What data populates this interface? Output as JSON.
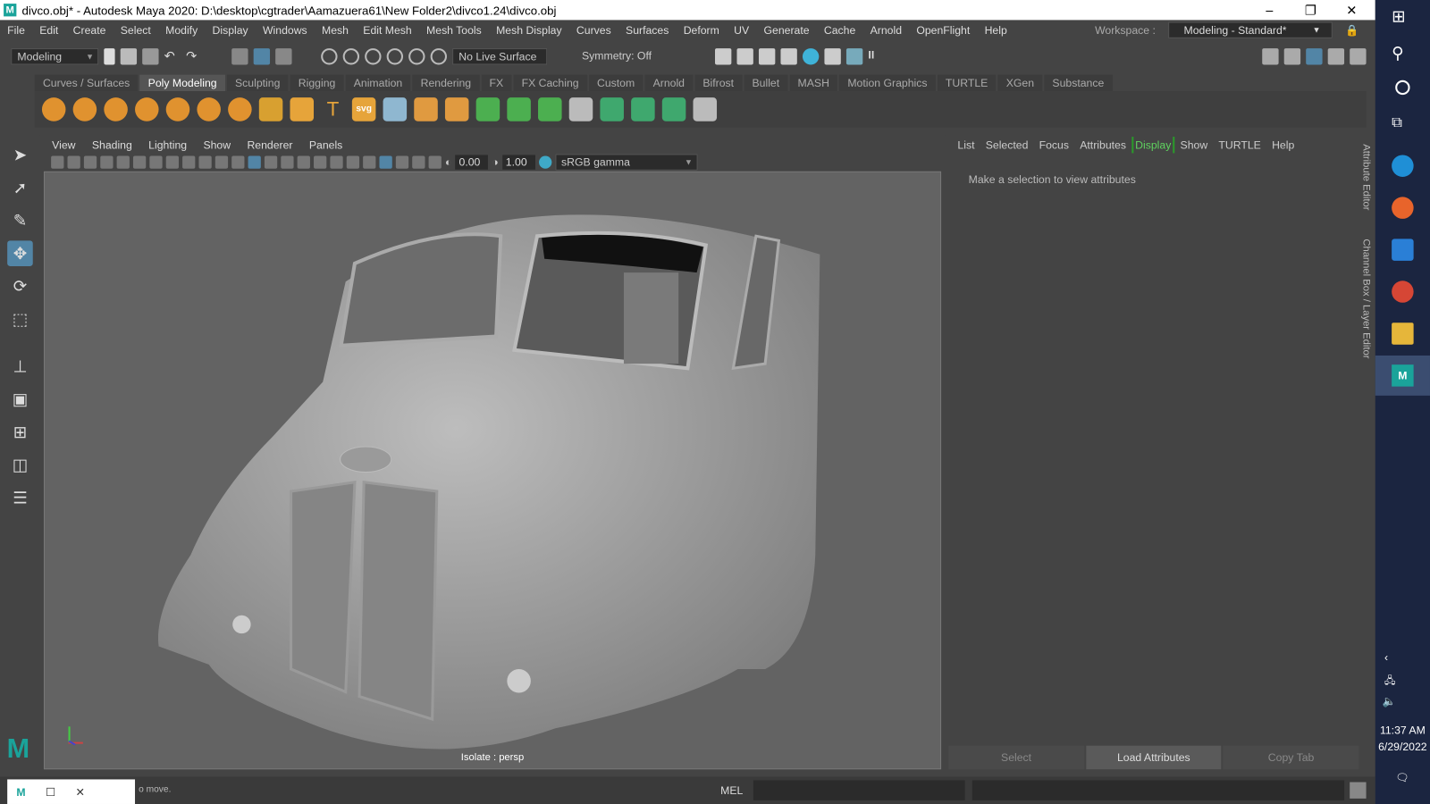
{
  "window": {
    "title": "divco.obj* - Autodesk Maya 2020: D:\\desktop\\cgtrader\\Aamazuera61\\New Folder2\\divco1.24\\divco.obj",
    "logo": "M",
    "minimize": "–",
    "restore": "❐",
    "close": "✕"
  },
  "menubar": [
    "File",
    "Edit",
    "Create",
    "Select",
    "Modify",
    "Display",
    "Windows",
    "Mesh",
    "Edit Mesh",
    "Mesh Tools",
    "Mesh Display",
    "Curves",
    "Surfaces",
    "Deform",
    "UV",
    "Generate",
    "Cache",
    "Arnold",
    "OpenFlight",
    "Help"
  ],
  "workspace": {
    "label": "Workspace :",
    "value": "Modeling - Standard*"
  },
  "statusline": {
    "mode": "Modeling",
    "live_surface": "No Live Surface",
    "symmetry": "Symmetry: Off"
  },
  "shelf_tabs": [
    "Curves / Surfaces",
    "Poly Modeling",
    "Sculpting",
    "Rigging",
    "Animation",
    "Rendering",
    "FX",
    "FX Caching",
    "Custom",
    "Arnold",
    "Bifrost",
    "Bullet",
    "MASH",
    "Motion Graphics",
    "TURTLE",
    "XGen",
    "Substance"
  ],
  "shelf_active": "Poly Modeling",
  "shelf_icons": [
    "sphere-icon",
    "cube-icon",
    "cylinder-icon",
    "cone-icon",
    "torus-icon",
    "plane-icon",
    "disc-icon",
    "platonic-icon",
    "star-icon",
    "text-icon",
    "svg-icon",
    "combine-icon",
    "separate-icon",
    "smooth-icon",
    "bevel-icon",
    "bridge-icon",
    "extrude-icon",
    "multicut-icon",
    "fill-hole-icon",
    "merge-icon",
    "mirror-icon",
    "uv-icon"
  ],
  "shelf_svg_label": "svg",
  "shelf_text_label": "T",
  "viewport": {
    "menu": [
      "View",
      "Shading",
      "Lighting",
      "Show",
      "Renderer",
      "Panels"
    ],
    "exposure": "0.00",
    "gamma": "1.00",
    "color_space": "sRGB gamma",
    "label": "Isolate : persp"
  },
  "attribute_editor": {
    "menu": [
      "List",
      "Selected",
      "Focus",
      "Attributes",
      "Display",
      "Show",
      "TURTLE",
      "Help"
    ],
    "message": "Make a selection to view attributes",
    "buttons": [
      "Select",
      "Load Attributes",
      "Copy Tab"
    ],
    "side_tabs": [
      "Attribute Editor",
      "Channel Box / Layer Editor"
    ]
  },
  "command_line": {
    "mel_label": "MEL",
    "help_text": "o move."
  },
  "taskbar": {
    "time": "11:37 AM",
    "date": "6/29/2022"
  },
  "colors": {
    "accent": "#5285a6",
    "display_green": "#5fd35f",
    "maya_teal": "#1aa39a"
  }
}
